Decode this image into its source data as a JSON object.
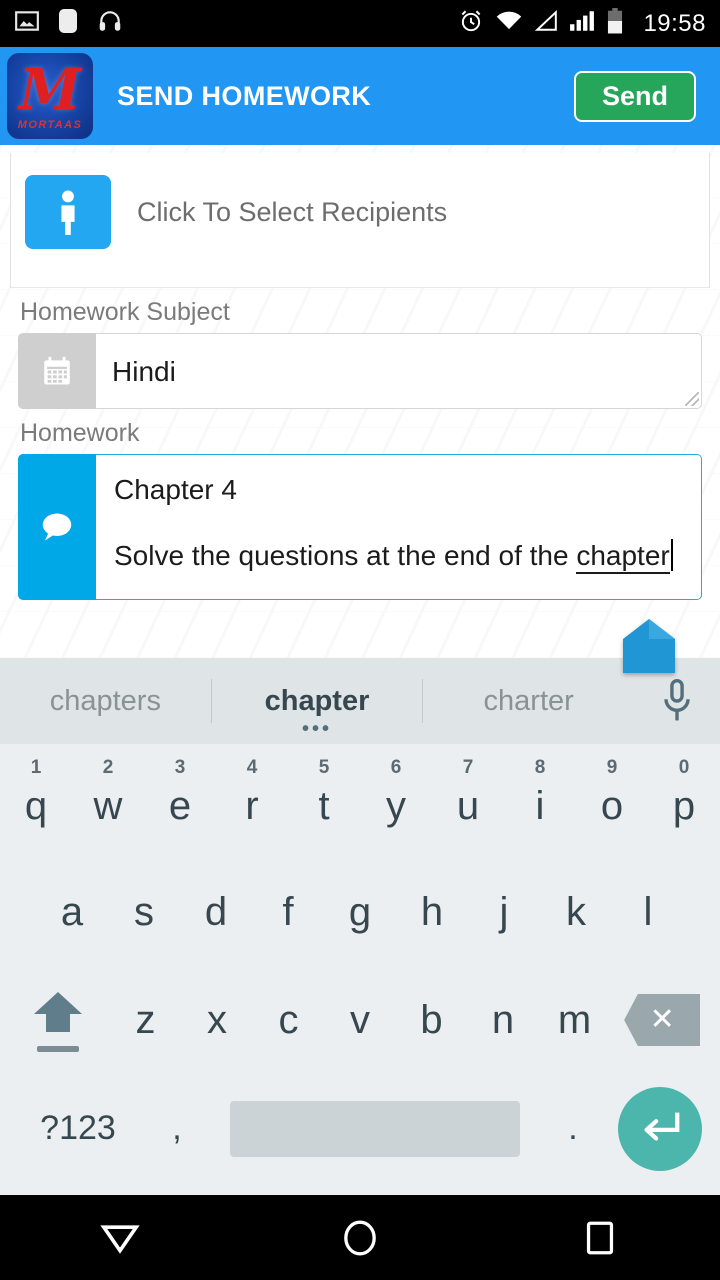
{
  "status_bar": {
    "time": "19:58",
    "left_icons": [
      "image-icon",
      "app-notification-icon",
      "headphones-icon"
    ],
    "right_icons": [
      "alarm-icon",
      "wifi-icon",
      "no-signal-icon",
      "signal-bars-icon",
      "battery-icon"
    ]
  },
  "app_bar": {
    "title": "SEND HOMEWORK",
    "send_label": "Send",
    "logo_letter": "M",
    "logo_brand": "MORTAAS",
    "accent_blue": "#2196f3",
    "send_green": "#26a65b"
  },
  "form": {
    "recipients": {
      "label": "Click To Select Recipients",
      "icon": "person-icon",
      "icon_bg": "#22a7f0"
    },
    "subject": {
      "label": "Homework Subject",
      "value": "Hindi",
      "icon": "calendar-icon",
      "icon_bg": "#cfcfcf"
    },
    "homework": {
      "label": "Homework",
      "line1": "Chapter 4",
      "line2_prefix": "Solve the questions at the end of the ",
      "line2_misspelled": "chapter",
      "icon": "chat-bubble-icon",
      "icon_bg": "#00a8e8",
      "focus_border": "#29a8e0"
    }
  },
  "keyboard": {
    "suggestions": [
      {
        "text": "chapters",
        "active": false
      },
      {
        "text": "chapter",
        "active": true
      },
      {
        "text": "charter",
        "active": false
      }
    ],
    "more_dots": "•••",
    "mic_icon": "microphone-icon",
    "row1": [
      {
        "letter": "q",
        "num": "1"
      },
      {
        "letter": "w",
        "num": "2"
      },
      {
        "letter": "e",
        "num": "3"
      },
      {
        "letter": "r",
        "num": "4"
      },
      {
        "letter": "t",
        "num": "5"
      },
      {
        "letter": "y",
        "num": "6"
      },
      {
        "letter": "u",
        "num": "7"
      },
      {
        "letter": "i",
        "num": "8"
      },
      {
        "letter": "o",
        "num": "9"
      },
      {
        "letter": "p",
        "num": "0"
      }
    ],
    "row2": [
      "a",
      "s",
      "d",
      "f",
      "g",
      "h",
      "j",
      "k",
      "l"
    ],
    "row3": [
      "z",
      "x",
      "c",
      "v",
      "b",
      "n",
      "m"
    ],
    "shift_icon": "shift-icon",
    "backspace_icon": "backspace-icon",
    "backspace_glyph": "✕",
    "symbols_label": "?123",
    "comma_label": ",",
    "period_label": ".",
    "space_label": "",
    "enter_icon": "enter-icon",
    "enter_color": "#4db6ac",
    "key_color": "#37474f",
    "bg": "#eceff1"
  },
  "nav_bar": {
    "back_icon": "hide-keyboard-icon",
    "home_icon": "home-circle-icon",
    "recents_icon": "recents-square-icon"
  }
}
